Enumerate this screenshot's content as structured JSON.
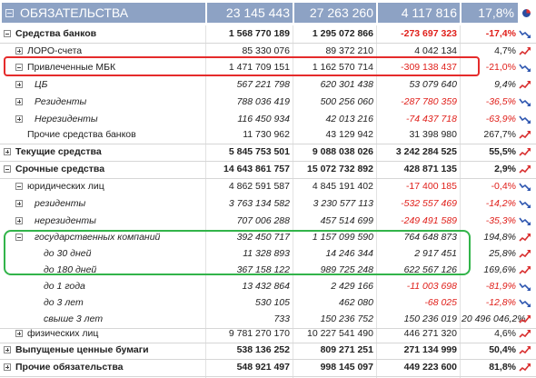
{
  "header": {
    "title": "ОБЯЗАТЕЛЬСТВА",
    "col1": "23 145 443 196",
    "col2": "27 263 260 132",
    "col3": "4 117 816 936",
    "col4": "17,8%"
  },
  "rows": [
    {
      "label": "Средства банков",
      "v1": "1 568 770 189",
      "v2": "1 295 072 866",
      "v3": "-273 697 323",
      "v4": "-17,4%"
    },
    {
      "label": "ЛОРО-счета",
      "v1": "85 330 076",
      "v2": "89 372 210",
      "v3": "4 042 134",
      "v4": "4,7%"
    },
    {
      "label": "Привлеченные МБК",
      "v1": "1 471 709 151",
      "v2": "1 162 570 714",
      "v3": "-309 138 437",
      "v4": "-21,0%"
    },
    {
      "label": "ЦБ",
      "v1": "567 221 798",
      "v2": "620 301 438",
      "v3": "53 079 640",
      "v4": "9,4%"
    },
    {
      "label": "Резиденты",
      "v1": "788 036 419",
      "v2": "500 256 060",
      "v3": "-287 780 359",
      "v4": "-36,5%"
    },
    {
      "label": "Нерезиденты",
      "v1": "116 450 934",
      "v2": "42 013 216",
      "v3": "-74 437 718",
      "v4": "-63,9%"
    },
    {
      "label": "Прочие средства банков",
      "v1": "11 730 962",
      "v2": "43 129 942",
      "v3": "31 398 980",
      "v4": "267,7%"
    },
    {
      "label": "Текущие средства",
      "v1": "5 845 753 501",
      "v2": "9 088 038 026",
      "v3": "3 242 284 525",
      "v4": "55,5%"
    },
    {
      "label": "Срочные средства",
      "v1": "14 643 861 757",
      "v2": "15 072 732 892",
      "v3": "428 871 135",
      "v4": "2,9%"
    },
    {
      "label": "юридических лиц",
      "v1": "4 862 591 587",
      "v2": "4 845 191 402",
      "v3": "-17 400 185",
      "v4": "-0,4%"
    },
    {
      "label": "резиденты",
      "v1": "3 763 134 582",
      "v2": "3 230 577 113",
      "v3": "-532 557 469",
      "v4": "-14,2%"
    },
    {
      "label": "нерезиденты",
      "v1": "707 006 288",
      "v2": "457 514 699",
      "v3": "-249 491 589",
      "v4": "-35,3%"
    },
    {
      "label": "государственных компаний",
      "v1": "392 450 717",
      "v2": "1 157 099 590",
      "v3": "764 648 873",
      "v4": "194,8%"
    },
    {
      "label": "до 30 дней",
      "v1": "11 328 893",
      "v2": "14 246 344",
      "v3": "2 917 451",
      "v4": "25,8%"
    },
    {
      "label": "до 180 дней",
      "v1": "367 158 122",
      "v2": "989 725 248",
      "v3": "622 567 126",
      "v4": "169,6%"
    },
    {
      "label": "до 1 года",
      "v1": "13 432 864",
      "v2": "2 429 166",
      "v3": "-11 003 698",
      "v4": "-81,9%"
    },
    {
      "label": "до 3 лет",
      "v1": "530 105",
      "v2": "462 080",
      "v3": "-68 025",
      "v4": "-12,8%"
    },
    {
      "label": "свыше 3 лет",
      "v1": "733",
      "v2": "150 236 752",
      "v3": "150 236 019",
      "v4": "20 496 046,2%"
    },
    {
      "label": "физических лиц",
      "v1": "9 781 270 170",
      "v2": "10 227 541 490",
      "v3": "446 271 320",
      "v4": "4,6%"
    },
    {
      "label": "Выпущеные ценные бумаги",
      "v1": "538 136 252",
      "v2": "809 271 251",
      "v3": "271 134 999",
      "v4": "50,4%"
    },
    {
      "label": "Прочие обязательства",
      "v1": "548 921 497",
      "v2": "998 145 097",
      "v3": "449 223 600",
      "v4": "81,8%"
    }
  ]
}
